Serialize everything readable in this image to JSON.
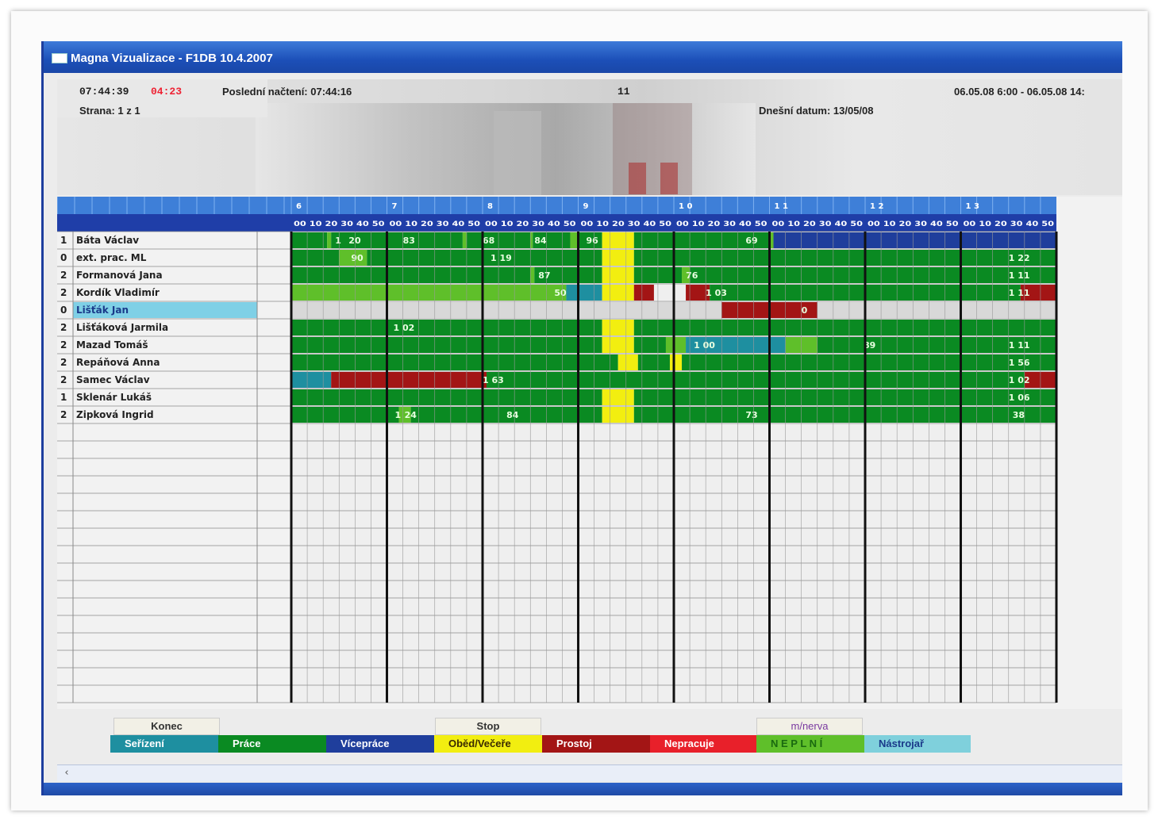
{
  "window": {
    "title": "Magna Vizualizace - F1DB 10.4.2007"
  },
  "header": {
    "clock": "07:44:39",
    "counter": "04:23",
    "last_read": "Poslední načtení: 07:44:16",
    "center_value": "11",
    "range": "06.05.08 6:00 - 06.05.08 14:",
    "page_label": "Strana:  1  z  1",
    "today": "Dnešní datum: 13/05/08"
  },
  "timeline": {
    "hours": [
      "6",
      "7",
      "8",
      "9",
      "1 0",
      "1 1",
      "1 2",
      "1 3"
    ],
    "minute_ticks": "00 10 20 30 40 50"
  },
  "employees": [
    {
      "num": "1",
      "name": "Báta Václav"
    },
    {
      "num": "0",
      "name": "ext. prac. ML"
    },
    {
      "num": "2",
      "name": "Formanová Jana"
    },
    {
      "num": "2",
      "name": "Kordík Vladimír"
    },
    {
      "num": "0",
      "name": "Lišťák Jan"
    },
    {
      "num": "2",
      "name": "Lišťáková Jarmila"
    },
    {
      "num": "2",
      "name": "Mazad Tomáš"
    },
    {
      "num": "2",
      "name": "Repáňová Anna"
    },
    {
      "num": "2",
      "name": "Samec Václav"
    },
    {
      "num": "1",
      "name": "Sklenár Lukáš"
    },
    {
      "num": "2",
      "name": "Zipková Ingrid"
    }
  ],
  "colors": {
    "serizeni": "#1e8fa0",
    "prace": "#0a8a22",
    "viceprace": "#1f3e9c",
    "obed": "#f2ee10",
    "prostoj": "#a31515",
    "nepracuje": "#e8202a",
    "neplni": "#5fbf2a",
    "nastrojar": "#7fd0dc",
    "empty": "#d8d8d8",
    "header_blue": "#1f3ea8",
    "selected_row": "#7fd0e6"
  },
  "gantt_rows": [
    {
      "segments": [
        [
          "prace",
          0,
          45
        ],
        [
          "neplni",
          45,
          50
        ],
        [
          "prace",
          50,
          215
        ],
        [
          "neplni",
          215,
          220
        ],
        [
          "prace",
          220,
          300
        ],
        [
          "neplni",
          300,
          303
        ],
        [
          "prace",
          303,
          350
        ],
        [
          "neplni",
          350,
          360
        ],
        [
          "prace",
          360,
          390
        ],
        [
          "obed",
          390,
          430
        ],
        [
          "prace",
          430,
          600
        ],
        [
          "neplni",
          600,
          605
        ],
        [
          "viceprace",
          605,
          960
        ]
      ],
      "labels": [
        [
          "1",
          55
        ],
        [
          "20",
          72
        ],
        [
          "83",
          140
        ],
        [
          "68",
          240
        ],
        [
          "84",
          305
        ],
        [
          "96",
          370
        ],
        [
          "69",
          570
        ]
      ]
    },
    {
      "segments": [
        [
          "prace",
          0,
          60
        ],
        [
          "neplni",
          60,
          95
        ],
        [
          "prace",
          95,
          390
        ],
        [
          "obed",
          390,
          430
        ],
        [
          "prace",
          430,
          960
        ]
      ],
      "labels": [
        [
          "90",
          75
        ],
        [
          "1 19",
          250
        ],
        [
          "1 22",
          900
        ]
      ]
    },
    {
      "segments": [
        [
          "prace",
          0,
          300
        ],
        [
          "neplni",
          300,
          305
        ],
        [
          "prace",
          305,
          390
        ],
        [
          "obed",
          390,
          430
        ],
        [
          "prace",
          430,
          490
        ],
        [
          "neplni",
          490,
          500
        ],
        [
          "prace",
          500,
          960
        ]
      ],
      "labels": [
        [
          "87",
          310
        ],
        [
          "76",
          495
        ],
        [
          "1 11",
          900
        ]
      ]
    },
    {
      "segments": [
        [
          "neplni",
          0,
          345
        ],
        [
          "serizeni",
          345,
          390
        ],
        [
          "obed",
          390,
          430
        ],
        [
          "prostoj",
          430,
          455
        ],
        [
          "prostoj",
          495,
          525
        ],
        [
          "prace",
          525,
          915
        ],
        [
          "prostoj",
          915,
          960
        ]
      ],
      "labels": [
        [
          "50",
          330
        ],
        [
          "1 03",
          520
        ],
        [
          "1 11",
          900
        ]
      ]
    },
    {
      "segments": [
        [
          "empty",
          0,
          540
        ],
        [
          "prostoj",
          540,
          660
        ],
        [
          "empty",
          660,
          960
        ]
      ],
      "labels": [
        [
          "0",
          640
        ]
      ]
    },
    {
      "segments": [
        [
          "prace",
          0,
          390
        ],
        [
          "obed",
          390,
          430
        ],
        [
          "prace",
          430,
          960
        ]
      ],
      "labels": [
        [
          "1 02",
          128
        ]
      ]
    },
    {
      "segments": [
        [
          "prace",
          0,
          390
        ],
        [
          "obed",
          390,
          430
        ],
        [
          "prace",
          430,
          470
        ],
        [
          "neplni",
          470,
          495
        ],
        [
          "serizeni",
          495,
          580
        ],
        [
          "serizeni",
          580,
          620
        ],
        [
          "neplni",
          620,
          660
        ],
        [
          "prace",
          660,
          960
        ]
      ],
      "labels": [
        [
          "1 00",
          505
        ],
        [
          "89",
          718
        ],
        [
          "1 11",
          900
        ]
      ]
    },
    {
      "segments": [
        [
          "prace",
          0,
          410
        ],
        [
          "obed",
          410,
          435
        ],
        [
          "prace",
          435,
          475
        ],
        [
          "obed",
          475,
          490
        ],
        [
          "prace",
          490,
          960
        ]
      ],
      "labels": [
        [
          "1 56",
          900
        ]
      ]
    },
    {
      "segments": [
        [
          "serizeni",
          0,
          50
        ],
        [
          "prostoj",
          50,
          245
        ],
        [
          "prace",
          245,
          920
        ],
        [
          "prostoj",
          920,
          960
        ]
      ],
      "labels": [
        [
          "1 63",
          240
        ],
        [
          "1 02",
          900
        ]
      ]
    },
    {
      "segments": [
        [
          "prace",
          0,
          390
        ],
        [
          "obed",
          390,
          430
        ],
        [
          "prace",
          430,
          960
        ]
      ],
      "labels": [
        [
          "1 06",
          900
        ]
      ]
    },
    {
      "segments": [
        [
          "prace",
          0,
          135
        ],
        [
          "neplni",
          135,
          150
        ],
        [
          "prace",
          150,
          390
        ],
        [
          "obed",
          390,
          430
        ],
        [
          "prace",
          430,
          960
        ]
      ],
      "labels": [
        [
          "1",
          130
        ],
        [
          "24",
          142
        ],
        [
          "84",
          270
        ],
        [
          "73",
          570
        ],
        [
          "38",
          905
        ]
      ]
    }
  ],
  "buttons": {
    "konec": "Konec",
    "stop": "Stop",
    "minerva": "m/nerva"
  },
  "legend": [
    {
      "key": "serizeni",
      "label": "Seřízení",
      "text_color": "#ffffff"
    },
    {
      "key": "prace",
      "label": "Práce",
      "text_color": "#ffffff"
    },
    {
      "key": "viceprace",
      "label": "Vícepráce",
      "text_color": "#ffffff"
    },
    {
      "key": "obed",
      "label": "Oběd/Večeře",
      "text_color": "#3a2a00"
    },
    {
      "key": "prostoj",
      "label": "Prostoj",
      "text_color": "#ffffff"
    },
    {
      "key": "nepracuje",
      "label": "Nepracuje",
      "text_color": "#ffffff"
    },
    {
      "key": "neplni",
      "label": "N E P L N Í",
      "text_color": "#1a6a10"
    },
    {
      "key": "nastrojar",
      "label": "Nástrojař",
      "text_color": "#1a3a8a"
    }
  ]
}
